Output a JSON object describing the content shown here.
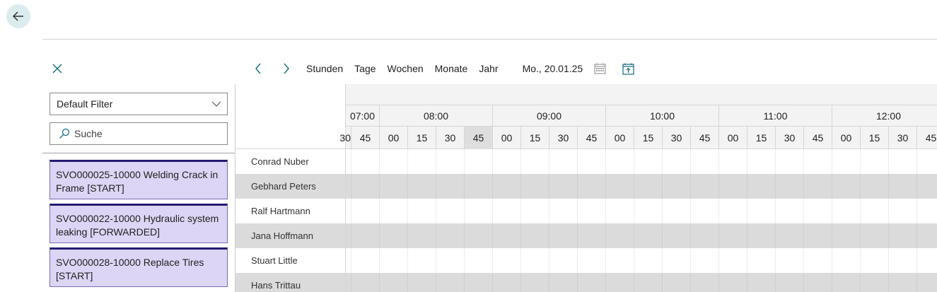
{
  "toolbar": {
    "views": [
      "Stunden",
      "Tage",
      "Wochen",
      "Monate",
      "Jahr"
    ],
    "date": "Mo., 20.01.25",
    "icons": {
      "back": "arrow-left-icon",
      "close": "close-icon",
      "prev": "chevron-left-icon",
      "next": "chevron-right-icon",
      "calendar": "calendar-icon",
      "today": "calendar-today-icon"
    }
  },
  "left_panel": {
    "filter_value": "Default Filter",
    "search_placeholder": "Suche",
    "orders": [
      {
        "line1": "SVO000025-10000 Welding Crack in",
        "line2": "Frame [START]"
      },
      {
        "line1": "SVO000022-10000 Hydraulic system",
        "line2": "leaking [FORWARDED]"
      },
      {
        "line1": "SVO000028-10000 Replace Tires",
        "line2": "[START]"
      }
    ]
  },
  "resources": [
    "Conrad Nuber",
    "Gebhard Peters",
    "Ralf Hartmann",
    "Jana Hoffmann",
    "Stuart Little",
    "Hans Trittau"
  ],
  "timeline": {
    "hours": [
      "07:00",
      "08:00",
      "09:00",
      "10:00",
      "11:00",
      "12:00"
    ],
    "minutes": [
      "30",
      "45",
      "00",
      "15",
      "30",
      "45",
      "00",
      "15",
      "30",
      "45",
      "00",
      "15",
      "30",
      "45",
      "00",
      "15",
      "30",
      "45",
      "00",
      "15",
      "30",
      "45"
    ],
    "highlighted_slot": "08:45"
  },
  "colors": {
    "back_button_bg": "#dcecee",
    "order_card_bg": "#ddd5f5",
    "order_card_top_border": "#241a73",
    "alt_row_bg": "#dbdbdb",
    "accent": "#0f6c7a"
  }
}
